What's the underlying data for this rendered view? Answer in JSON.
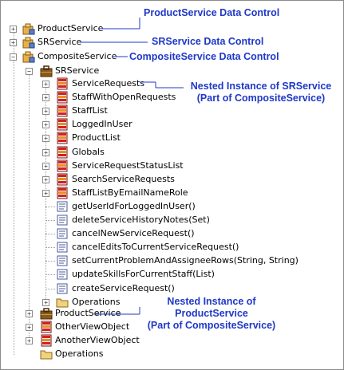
{
  "tree": {
    "product_service": "ProductService",
    "sr_service": "SRService",
    "composite_service": "CompositeService",
    "nested_sr_service": "SRService",
    "sr_children": [
      {
        "label": "ServiceRequests",
        "icon": "view-object-icon"
      },
      {
        "label": "StaffWithOpenRequests",
        "icon": "view-object-icon"
      },
      {
        "label": "StaffList",
        "icon": "view-object-icon"
      },
      {
        "label": "LoggedInUser",
        "icon": "view-object-icon"
      },
      {
        "label": "ProductList",
        "icon": "view-object-icon"
      },
      {
        "label": "Globals",
        "icon": "view-object-icon"
      },
      {
        "label": "ServiceRequestStatusList",
        "icon": "view-object-icon"
      },
      {
        "label": "SearchServiceRequests",
        "icon": "view-object-icon"
      },
      {
        "label": "StaffListByEmailNameRole",
        "icon": "view-object-icon"
      },
      {
        "label": "getUserIdForLoggedInUser()",
        "icon": "method-icon"
      },
      {
        "label": "deleteServiceHistoryNotes(Set)",
        "icon": "method-icon"
      },
      {
        "label": "cancelNewServiceRequest()",
        "icon": "method-icon"
      },
      {
        "label": "cancelEditsToCurrentServiceRequest()",
        "icon": "method-icon"
      },
      {
        "label": "setCurrentProblemAndAssigneeRows(String, String)",
        "icon": "method-icon"
      },
      {
        "label": "updateSkillsForCurrentStaff(List)",
        "icon": "method-icon"
      },
      {
        "label": "createServiceRequest()",
        "icon": "method-icon"
      },
      {
        "label": "Operations",
        "icon": "folder-icon"
      }
    ],
    "nested_product_service": "ProductService",
    "other_view_object": "OtherViewObject",
    "another_view_object": "AnotherViewObject",
    "operations": "Operations"
  },
  "callouts": {
    "product_service": "ProductService Data Control",
    "sr_service": "SRService Data Control",
    "composite_service": "CompositeService Data Control",
    "nested_sr_line1": "Nested Instance of SRService",
    "nested_sr_line2": "(Part of CompositeService)",
    "nested_ps_line1": "Nested Instance of",
    "nested_ps_line2": "ProductService",
    "nested_ps_line3": "(Part of CompositeService)"
  },
  "colors": {
    "callout": "#1f38c8"
  }
}
